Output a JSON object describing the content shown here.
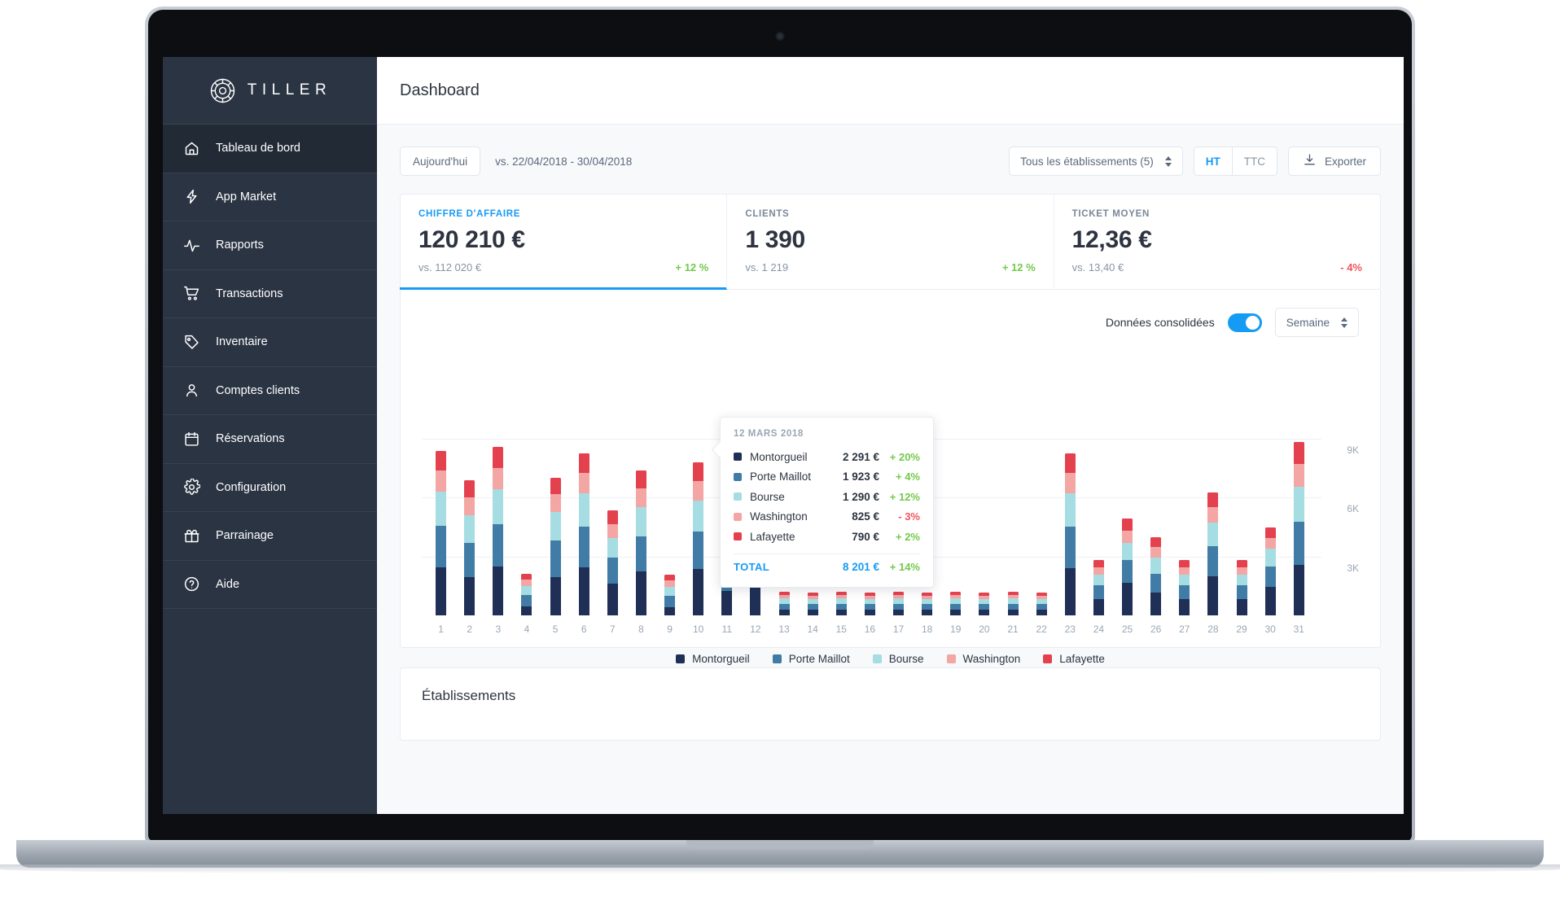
{
  "app": {
    "brand": "TILLER",
    "page_title": "Dashboard"
  },
  "sidebar": {
    "items": [
      {
        "label": "Tableau de bord",
        "icon": "home-icon",
        "active": true
      },
      {
        "label": "App Market",
        "icon": "bolt-icon",
        "active": false
      },
      {
        "label": "Rapports",
        "icon": "pulse-icon",
        "active": false
      },
      {
        "label": "Transactions",
        "icon": "cart-icon",
        "active": false
      },
      {
        "label": "Inventaire",
        "icon": "tag-icon",
        "active": false
      },
      {
        "label": "Comptes clients",
        "icon": "user-icon",
        "active": false
      },
      {
        "label": "Réservations",
        "icon": "calendar-icon",
        "active": false
      },
      {
        "label": "Configuration",
        "icon": "gear-icon",
        "active": false
      },
      {
        "label": "Parrainage",
        "icon": "gift-icon",
        "active": false
      },
      {
        "label": "Aide",
        "icon": "help-circle-icon",
        "active": false
      }
    ]
  },
  "toolbar": {
    "period_button": "Aujourd'hui",
    "comparison": "vs. 22/04/2018 - 30/04/2018",
    "establishment_select": "Tous les établissements (5)",
    "tax_options": [
      "HT",
      "TTC"
    ],
    "tax_selected": "HT",
    "export_label": "Exporter"
  },
  "kpis": [
    {
      "label": "CHIFFRE D'AFFAIRE",
      "value": "120 210 €",
      "previous": "vs. 112 020 €",
      "delta": "+ 12 %",
      "direction": "up"
    },
    {
      "label": "CLIENTS",
      "value": "1 390",
      "previous": "vs. 1 219",
      "delta": "+ 12 %",
      "direction": "up"
    },
    {
      "label": "TICKET MOYEN",
      "value": "12,36 €",
      "previous": "vs. 13,40 €",
      "delta": "- 4%",
      "direction": "down"
    }
  ],
  "chart_controls": {
    "consolidated_label": "Données consolidées",
    "consolidated_on": true,
    "granularity": "Semaine"
  },
  "tooltip": {
    "date": "12 MARS 2018",
    "rows": [
      {
        "name": "Montorgueil",
        "value": "2 291 €",
        "delta": "+ 20%",
        "direction": "up",
        "color": "#1f2f55"
      },
      {
        "name": "Porte Maillot",
        "value": "1 923 €",
        "delta": "+ 4%",
        "direction": "up",
        "color": "#417ca6"
      },
      {
        "name": "Bourse",
        "value": "1 290 €",
        "delta": "+ 12%",
        "direction": "up",
        "color": "#a5dde2"
      },
      {
        "name": "Washington",
        "value": "825 €",
        "delta": "- 3%",
        "direction": "down",
        "color": "#f3a6a3"
      },
      {
        "name": "Lafayette",
        "value": "790 €",
        "delta": "+ 2%",
        "direction": "up",
        "color": "#e4414f"
      }
    ],
    "total_label": "TOTAL",
    "total_value": "8 201 €",
    "total_delta": "+ 14%"
  },
  "bottom": {
    "title": "Établissements"
  },
  "colors": {
    "accent": "#169bf5",
    "positive": "#72c94b",
    "negative": "#f0545f",
    "sidebar": "#2b3443",
    "montorgueil": "#1f2f55",
    "porte_maillot": "#417ca6",
    "bourse": "#a5dde2",
    "washington": "#f3a6a3",
    "lafayette": "#e4414f"
  },
  "chart_data": {
    "type": "bar",
    "stacked": true,
    "title": "",
    "xlabel": "",
    "ylabel": "",
    "ylim": [
      0,
      12000
    ],
    "yticks": [
      3000,
      6000,
      9000
    ],
    "ytick_labels": [
      "3K",
      "6K",
      "9K"
    ],
    "grid": true,
    "legend_position": "bottom",
    "categories": [
      "1",
      "2",
      "3",
      "4",
      "5",
      "6",
      "7",
      "8",
      "9",
      "10",
      "11",
      "12",
      "13",
      "14",
      "15",
      "16",
      "17",
      "18",
      "19",
      "20",
      "21",
      "22",
      "23",
      "24",
      "25",
      "26",
      "27",
      "28",
      "29",
      "30",
      "31"
    ],
    "legend": [
      "Montorgueil",
      "Porte Maillot",
      "Bourse",
      "Washington",
      "Lafayette"
    ],
    "series": [
      {
        "name": "Montorgueil",
        "color": "#1f2f55",
        "values": [
          2450,
          1950,
          2500,
          450,
          1950,
          2450,
          1600,
          2250,
          400,
          2350,
          1250,
          3000,
          300,
          280,
          300,
          290,
          300,
          290,
          300,
          290,
          300,
          290,
          2400,
          820,
          1650,
          1150,
          820,
          2000,
          820,
          1450,
          2550
        ]
      },
      {
        "name": "Porte Maillot",
        "color": "#417ca6",
        "values": [
          2100,
          1750,
          2150,
          600,
          1850,
          2050,
          1350,
          1750,
          600,
          1900,
          1100,
          2600,
          300,
          290,
          300,
          290,
          300,
          290,
          300,
          290,
          300,
          290,
          2100,
          700,
          1150,
          950,
          700,
          1500,
          700,
          1050,
          2200
        ]
      },
      {
        "name": "Bourse",
        "color": "#a5dde2",
        "values": [
          1750,
          1400,
          1750,
          450,
          1450,
          1700,
          1000,
          1500,
          450,
          1600,
          900,
          1900,
          250,
          240,
          250,
          240,
          250,
          240,
          250,
          240,
          250,
          240,
          1700,
          550,
          900,
          820,
          550,
          1200,
          550,
          880,
          1800
        ]
      },
      {
        "name": "Washington",
        "color": "#f3a6a3",
        "values": [
          1050,
          900,
          1100,
          330,
          900,
          1050,
          700,
          950,
          320,
          1000,
          600,
          1200,
          180,
          170,
          180,
          170,
          180,
          170,
          180,
          170,
          180,
          170,
          1050,
          380,
          620,
          550,
          380,
          800,
          380,
          560,
          1150
        ]
      },
      {
        "name": "Lafayette",
        "color": "#e4414f",
        "values": [
          1000,
          880,
          1050,
          300,
          860,
          1000,
          680,
          900,
          300,
          950,
          560,
          1150,
          170,
          160,
          170,
          160,
          170,
          160,
          170,
          160,
          170,
          160,
          1000,
          350,
          600,
          520,
          350,
          760,
          350,
          530,
          1100
        ]
      }
    ]
  }
}
